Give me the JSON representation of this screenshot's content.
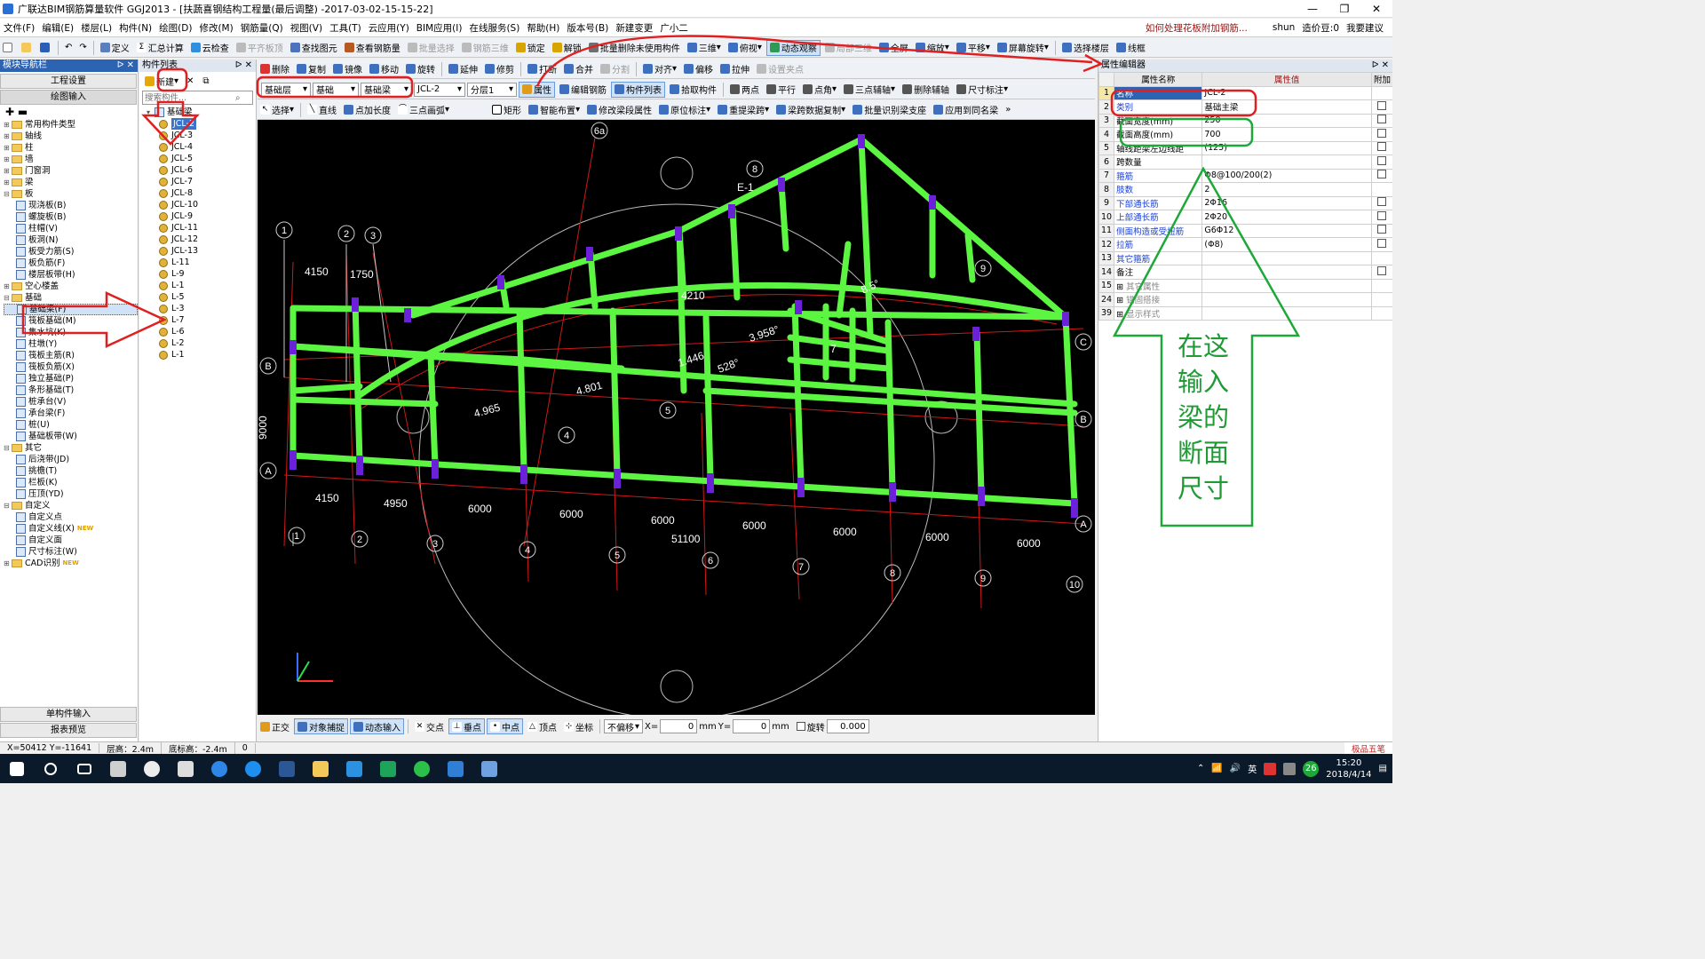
{
  "window": {
    "title": "广联达BIM钢筋算量软件 GGJ2013 - [扶蔬喜钢结构工程量(最后调整) -2017-03-02-15-15-22]",
    "controls": [
      "—",
      "❐",
      "✕"
    ]
  },
  "menu": [
    "文件(F)",
    "编辑(E)",
    "楼层(L)",
    "构件(N)",
    "绘图(D)",
    "修改(M)",
    "钢筋量(Q)",
    "视图(V)",
    "工具(T)",
    "云应用(Y)",
    "BIM应用(I)",
    "在线服务(S)",
    "帮助(H)",
    "版本号(B)",
    "新建变更",
    "广小二"
  ],
  "top_right": {
    "hint": "如何处理花板附加钢筋...",
    "user": "shun",
    "price": "造价豆:0",
    "suggest": "我要建议"
  },
  "toolbar1": [
    "定义",
    "汇总计算",
    "云检查",
    "平齐板顶",
    "查找图元",
    "查看钢筋量",
    "批量选择",
    "钢筋三维",
    "锁定",
    "解锁",
    "批量删除未使用构件",
    "三维",
    "俯视",
    "动态观察",
    "局部三维",
    "全屏",
    "缩放",
    "平移",
    "屏幕旋转",
    "选择楼层",
    "线框"
  ],
  "toolbar2": [
    "删除",
    "复制",
    "镜像",
    "移动",
    "旋转",
    "延伸",
    "修剪",
    "打断",
    "合并",
    "分割",
    "对齐",
    "偏移",
    "拉伸",
    "设置夹点"
  ],
  "toolbar3": {
    "layer": "基础层",
    "type": "基础",
    "subtype": "基础梁",
    "component": "JCL-2",
    "sublayer": "分层1",
    "buttons": [
      "属性",
      "编辑钢筋",
      "构件列表",
      "拾取构件",
      "两点",
      "平行",
      "点角",
      "三点辅轴",
      "删除辅轴",
      "尺寸标注"
    ]
  },
  "toolbar4": [
    "选择",
    "直线",
    "点加长度",
    "三点画弧",
    "矩形",
    "智能布置",
    "修改梁段属性",
    "原位标注",
    "重提梁跨",
    "梁跨数据复制",
    "批量识别梁支座",
    "应用到同名梁"
  ],
  "nav": {
    "title": "模块导航栏",
    "project_settings": "工程设置",
    "drawing_input": "绘图输入",
    "tree": [
      {
        "level": 0,
        "label": "常用构件类型",
        "kind": "folder",
        "exp": "+"
      },
      {
        "level": 0,
        "label": "轴线",
        "kind": "folder",
        "exp": "+"
      },
      {
        "level": 0,
        "label": "柱",
        "kind": "folder",
        "exp": "+"
      },
      {
        "level": 0,
        "label": "墙",
        "kind": "folder",
        "exp": "+"
      },
      {
        "level": 0,
        "label": "门窗洞",
        "kind": "folder",
        "exp": "+"
      },
      {
        "level": 0,
        "label": "梁",
        "kind": "folder",
        "exp": "+"
      },
      {
        "level": 0,
        "label": "板",
        "kind": "folder",
        "exp": "-"
      },
      {
        "level": 1,
        "label": "现浇板(B)",
        "kind": "item"
      },
      {
        "level": 1,
        "label": "螺旋板(B)",
        "kind": "item"
      },
      {
        "level": 1,
        "label": "柱帽(V)",
        "kind": "item"
      },
      {
        "level": 1,
        "label": "板洞(N)",
        "kind": "item"
      },
      {
        "level": 1,
        "label": "板受力筋(S)",
        "kind": "item"
      },
      {
        "level": 1,
        "label": "板负筋(F)",
        "kind": "item"
      },
      {
        "level": 1,
        "label": "楼层板带(H)",
        "kind": "item"
      },
      {
        "level": 0,
        "label": "空心楼盖",
        "kind": "folder",
        "exp": "+"
      },
      {
        "level": 0,
        "label": "基础",
        "kind": "folder",
        "exp": "-"
      },
      {
        "level": 1,
        "label": "基础梁(F)",
        "kind": "item",
        "selected": true
      },
      {
        "level": 1,
        "label": "筏板基础(M)",
        "kind": "item"
      },
      {
        "level": 1,
        "label": "集水坑(K)",
        "kind": "item"
      },
      {
        "level": 1,
        "label": "柱墩(Y)",
        "kind": "item"
      },
      {
        "level": 1,
        "label": "筏板主筋(R)",
        "kind": "item"
      },
      {
        "level": 1,
        "label": "筏板负筋(X)",
        "kind": "item"
      },
      {
        "level": 1,
        "label": "独立基础(P)",
        "kind": "item"
      },
      {
        "level": 1,
        "label": "条形基础(T)",
        "kind": "item"
      },
      {
        "level": 1,
        "label": "桩承台(V)",
        "kind": "item"
      },
      {
        "level": 1,
        "label": "承台梁(F)",
        "kind": "item"
      },
      {
        "level": 1,
        "label": "桩(U)",
        "kind": "item"
      },
      {
        "level": 1,
        "label": "基础板带(W)",
        "kind": "item"
      },
      {
        "level": 0,
        "label": "其它",
        "kind": "folder",
        "exp": "-"
      },
      {
        "level": 1,
        "label": "后浇带(JD)",
        "kind": "item"
      },
      {
        "level": 1,
        "label": "挑檐(T)",
        "kind": "item"
      },
      {
        "level": 1,
        "label": "栏板(K)",
        "kind": "item"
      },
      {
        "level": 1,
        "label": "压顶(YD)",
        "kind": "item"
      },
      {
        "level": 0,
        "label": "自定义",
        "kind": "folder",
        "exp": "-"
      },
      {
        "level": 1,
        "label": "自定义点",
        "kind": "item"
      },
      {
        "level": 1,
        "label": "自定义线(X)",
        "kind": "item",
        "badge": "NEW"
      },
      {
        "level": 1,
        "label": "自定义面",
        "kind": "item"
      },
      {
        "level": 1,
        "label": "尺寸标注(W)",
        "kind": "item"
      },
      {
        "level": 0,
        "label": "CAD识别",
        "kind": "folder",
        "exp": "+",
        "badge": "NEW"
      }
    ],
    "single_input": "单构件输入",
    "report": "报表预览"
  },
  "complist": {
    "title": "构件列表",
    "new_label": "新建",
    "search_placeholder": "搜索构件...",
    "group": "基础梁",
    "items": [
      "JCL-2",
      "JCL-3",
      "JCL-4",
      "JCL-5",
      "JCL-6",
      "JCL-7",
      "JCL-8",
      "JCL-10",
      "JCL-9",
      "JCL-11",
      "JCL-12",
      "JCL-13",
      "L-11",
      "L-9",
      "L-1",
      "L-5",
      "L-3",
      "L-7",
      "L-6",
      "L-2",
      "L-1"
    ],
    "selected": "JCL-2"
  },
  "props": {
    "title": "属性编辑器",
    "headers": [
      "属性名称",
      "属性值",
      "附加"
    ],
    "rows": [
      {
        "no": "1",
        "name": "名称",
        "value": "JCL-2",
        "blue": true,
        "sel": true,
        "chk": false
      },
      {
        "no": "2",
        "name": "类别",
        "value": "基础主梁",
        "blue": true,
        "chk": true
      },
      {
        "no": "3",
        "name": "截面宽度(mm)",
        "value": "250",
        "blue": false,
        "chk": true
      },
      {
        "no": "4",
        "name": "截面高度(mm)",
        "value": "700",
        "blue": false,
        "chk": true
      },
      {
        "no": "5",
        "name": "轴线距梁左边线距",
        "value": "(125)",
        "blue": false,
        "chk": true
      },
      {
        "no": "6",
        "name": "跨数量",
        "value": "",
        "blue": false,
        "chk": true
      },
      {
        "no": "7",
        "name": "箍筋",
        "value": "Φ8@100/200(2)",
        "blue": true,
        "chk": true
      },
      {
        "no": "8",
        "name": "肢数",
        "value": "2",
        "blue": true,
        "chk": false
      },
      {
        "no": "9",
        "name": "下部通长筋",
        "value": "2Φ16",
        "blue": true,
        "chk": true
      },
      {
        "no": "10",
        "name": "上部通长筋",
        "value": "2Φ20",
        "blue": true,
        "chk": true
      },
      {
        "no": "11",
        "name": "侧面构造或受扭筋",
        "value": "G6Φ12",
        "blue": true,
        "chk": true
      },
      {
        "no": "12",
        "name": "拉筋",
        "value": "(Φ8)",
        "blue": true,
        "chk": true
      },
      {
        "no": "13",
        "name": "其它箍筋",
        "value": "",
        "blue": true,
        "chk": false
      },
      {
        "no": "14",
        "name": "备注",
        "value": "",
        "blue": false,
        "chk": true
      },
      {
        "no": "15",
        "name": "其它属性",
        "value": "",
        "gray": true,
        "exp": "+"
      },
      {
        "no": "24",
        "name": "锚固搭接",
        "value": "",
        "gray": true,
        "exp": "+"
      },
      {
        "no": "39",
        "name": "显示样式",
        "value": "",
        "gray": true,
        "exp": "+"
      }
    ]
  },
  "annotation_text": "在这输入梁的断面尺寸",
  "cad": {
    "axis_numbers": [
      "1",
      "2",
      "3",
      "4",
      "5",
      "6",
      "7",
      "8",
      "9",
      "10"
    ],
    "axis_letters": [
      "A",
      "B",
      "C"
    ],
    "top_dims": [
      "4150",
      "1750",
      "4210"
    ],
    "bottom_dims": [
      "4150",
      "4950",
      "6000",
      "6000",
      "6000",
      "6000",
      "6000",
      "6000",
      "6000"
    ],
    "total_dim": "51100",
    "side_dim": "9000",
    "labels": [
      "6a",
      "E-1",
      "3.958°",
      "4.965",
      "4.801",
      "1.446",
      "528°",
      "8.5°",
      "4",
      "5",
      "7",
      "8",
      "9",
      "2",
      "1"
    ]
  },
  "snapbar": {
    "items": [
      "正交",
      "对象捕捉",
      "动态输入",
      "交点",
      "垂点",
      "中点",
      "顶点",
      "坐标",
      "不偏移"
    ],
    "x_label": "X=",
    "x": "0",
    "y_label": "Y=",
    "y": "0",
    "unit": "mm",
    "rotate_label": "旋转",
    "rotate": "0.000"
  },
  "status": {
    "coords": "X=50412 Y=-11641",
    "floor_h": "层高：2.4m",
    "bottom_h": "底标高：-2.4m",
    "val": "0",
    "ime": "极品五笔"
  },
  "taskbar": {
    "time": "15:20",
    "date": "2018/4/14",
    "lang": "英",
    "badge": "26"
  },
  "colors": {
    "beam": "#5cf542",
    "column": "#6b21d8",
    "red_arrow": "#e02020",
    "green_arrow": "#1fa83a",
    "nav_blue": "#2c63b3"
  }
}
